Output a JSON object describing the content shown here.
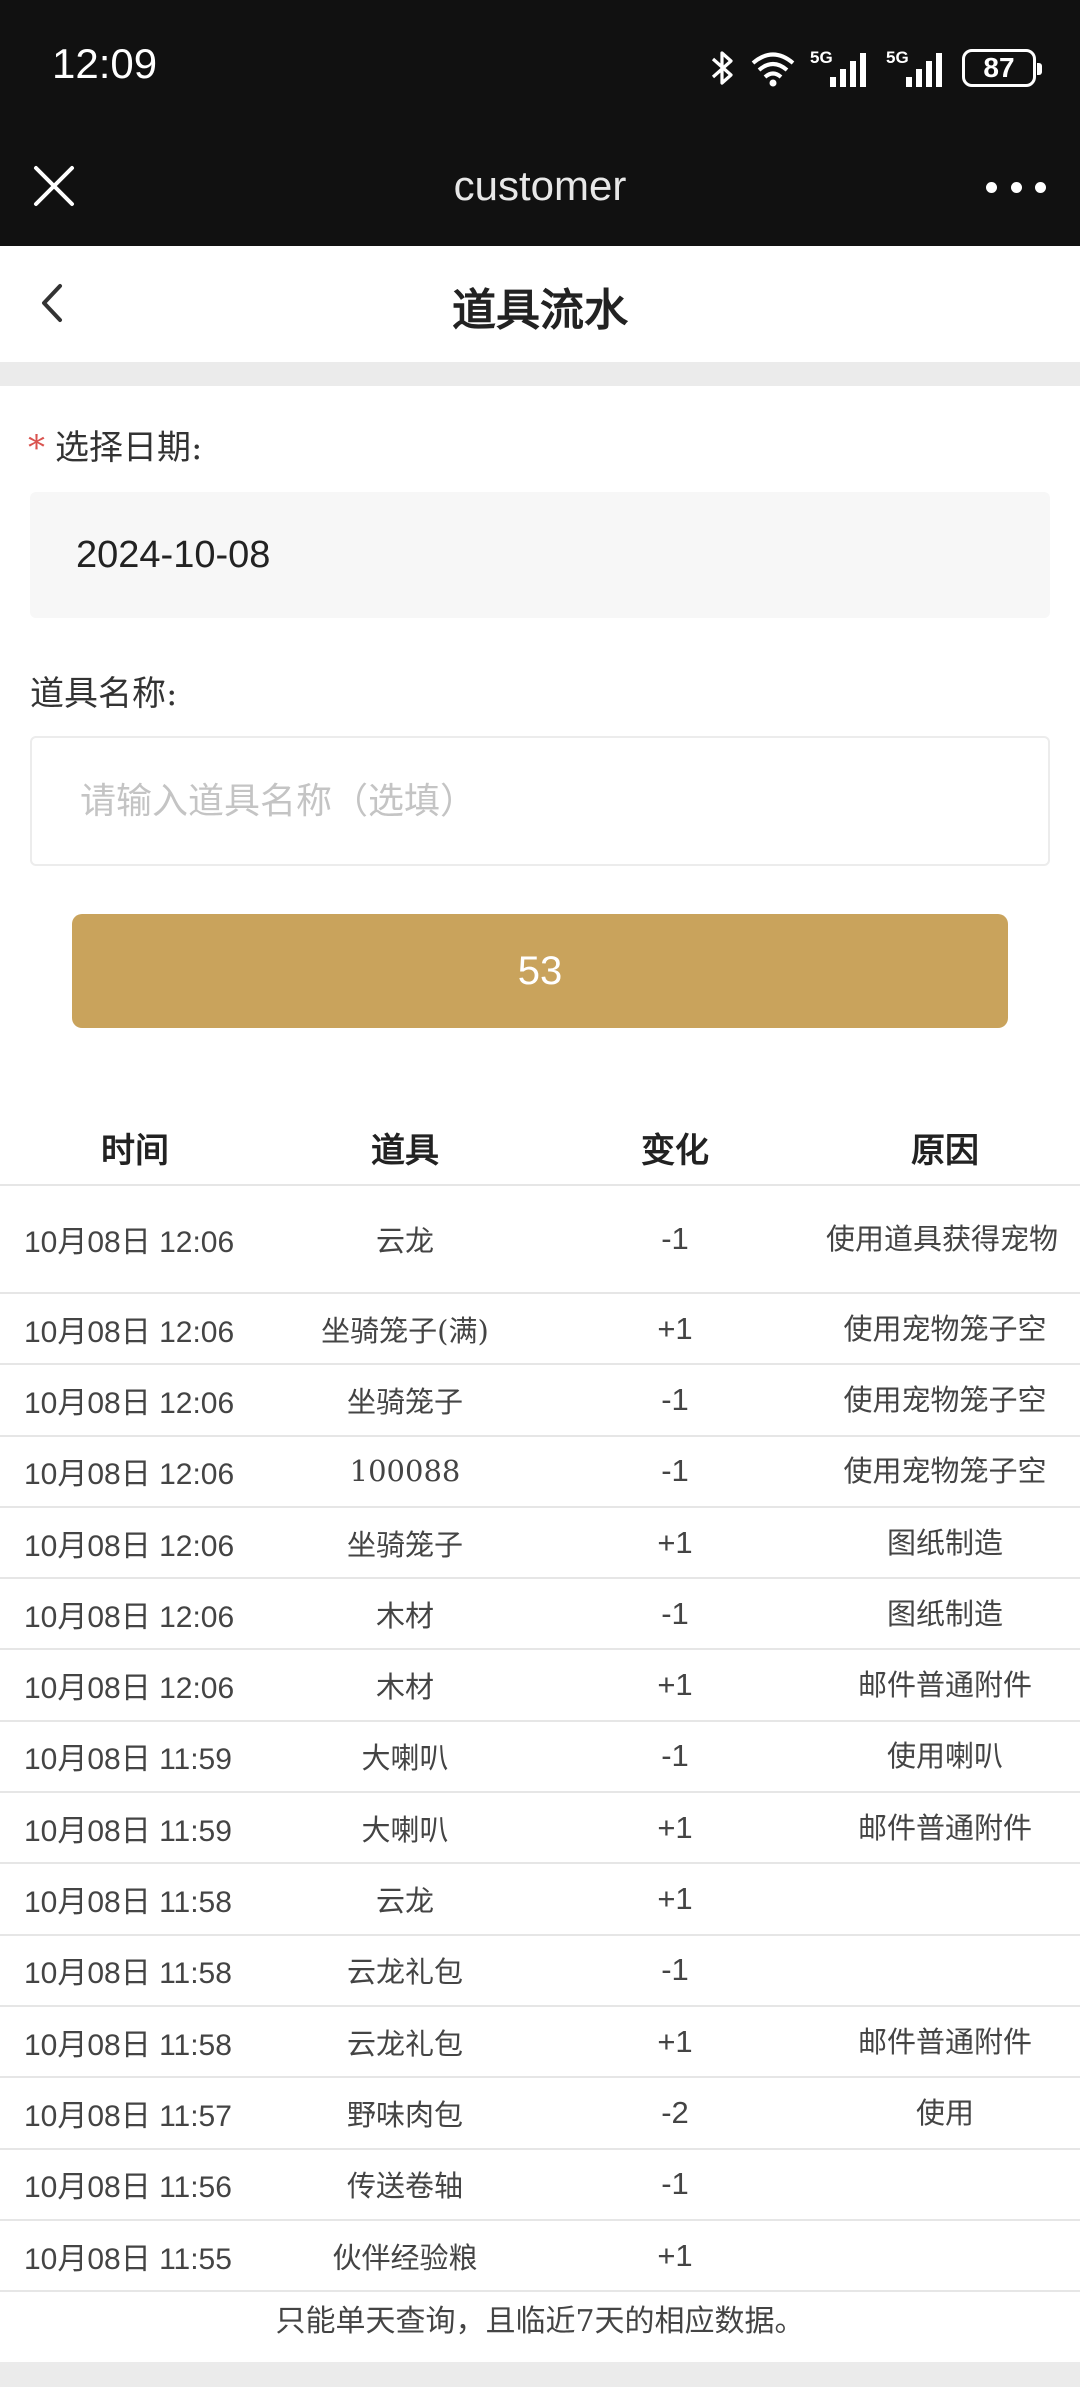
{
  "status_bar": {
    "time": "12:09",
    "battery": "87",
    "network_1": "5G",
    "network_2": "5G"
  },
  "browser": {
    "title": "customer"
  },
  "page": {
    "title": "道具流水"
  },
  "form": {
    "date_label": "选择日期:",
    "required_mark": "*",
    "date_value": "2024-10-08",
    "name_label": "道具名称:",
    "name_placeholder": "请输入道具名称（选填）",
    "query_button": "53"
  },
  "table": {
    "headers": [
      "时间",
      "道具",
      "变化",
      "原因"
    ],
    "rows": [
      {
        "time": "10月08日  12:06",
        "item": "云龙",
        "change": "-1",
        "reason": "使用道具获得宠物"
      },
      {
        "time": "10月08日  12:06",
        "item": "坐骑笼子(满)",
        "change": "+1",
        "reason": "使用宠物笼子空"
      },
      {
        "time": "10月08日  12:06",
        "item": "坐骑笼子",
        "change": "-1",
        "reason": "使用宠物笼子空"
      },
      {
        "time": "10月08日  12:06",
        "item": "100088",
        "change": "-1",
        "reason": "使用宠物笼子空"
      },
      {
        "time": "10月08日  12:06",
        "item": "坐骑笼子",
        "change": "+1",
        "reason": "图纸制造"
      },
      {
        "time": "10月08日  12:06",
        "item": "木材",
        "change": "-1",
        "reason": "图纸制造"
      },
      {
        "time": "10月08日  12:06",
        "item": "木材",
        "change": "+1",
        "reason": "邮件普通附件"
      },
      {
        "time": "10月08日  11:59",
        "item": "大喇叭",
        "change": "-1",
        "reason": "使用喇叭"
      },
      {
        "time": "10月08日  11:59",
        "item": "大喇叭",
        "change": "+1",
        "reason": "邮件普通附件"
      },
      {
        "time": "10月08日  11:58",
        "item": "云龙",
        "change": "+1",
        "reason": ""
      },
      {
        "time": "10月08日  11:58",
        "item": "云龙礼包",
        "change": "-1",
        "reason": ""
      },
      {
        "time": "10月08日  11:58",
        "item": "云龙礼包",
        "change": "+1",
        "reason": "邮件普通附件"
      },
      {
        "time": "10月08日  11:57",
        "item": "野味肉包",
        "change": "-2",
        "reason": "使用"
      },
      {
        "time": "10月08日  11:56",
        "item": "传送卷轴",
        "change": "-1",
        "reason": ""
      },
      {
        "time": "10月08日  11:55",
        "item": "伙伴经验粮",
        "change": "+1",
        "reason": ""
      }
    ]
  },
  "footer": {
    "note": "只能单天查询，且临近7天的相应数据。"
  },
  "colors": {
    "accent": "#c9a35c",
    "required": "#d9534f",
    "status_bar_bg": "#111111"
  }
}
